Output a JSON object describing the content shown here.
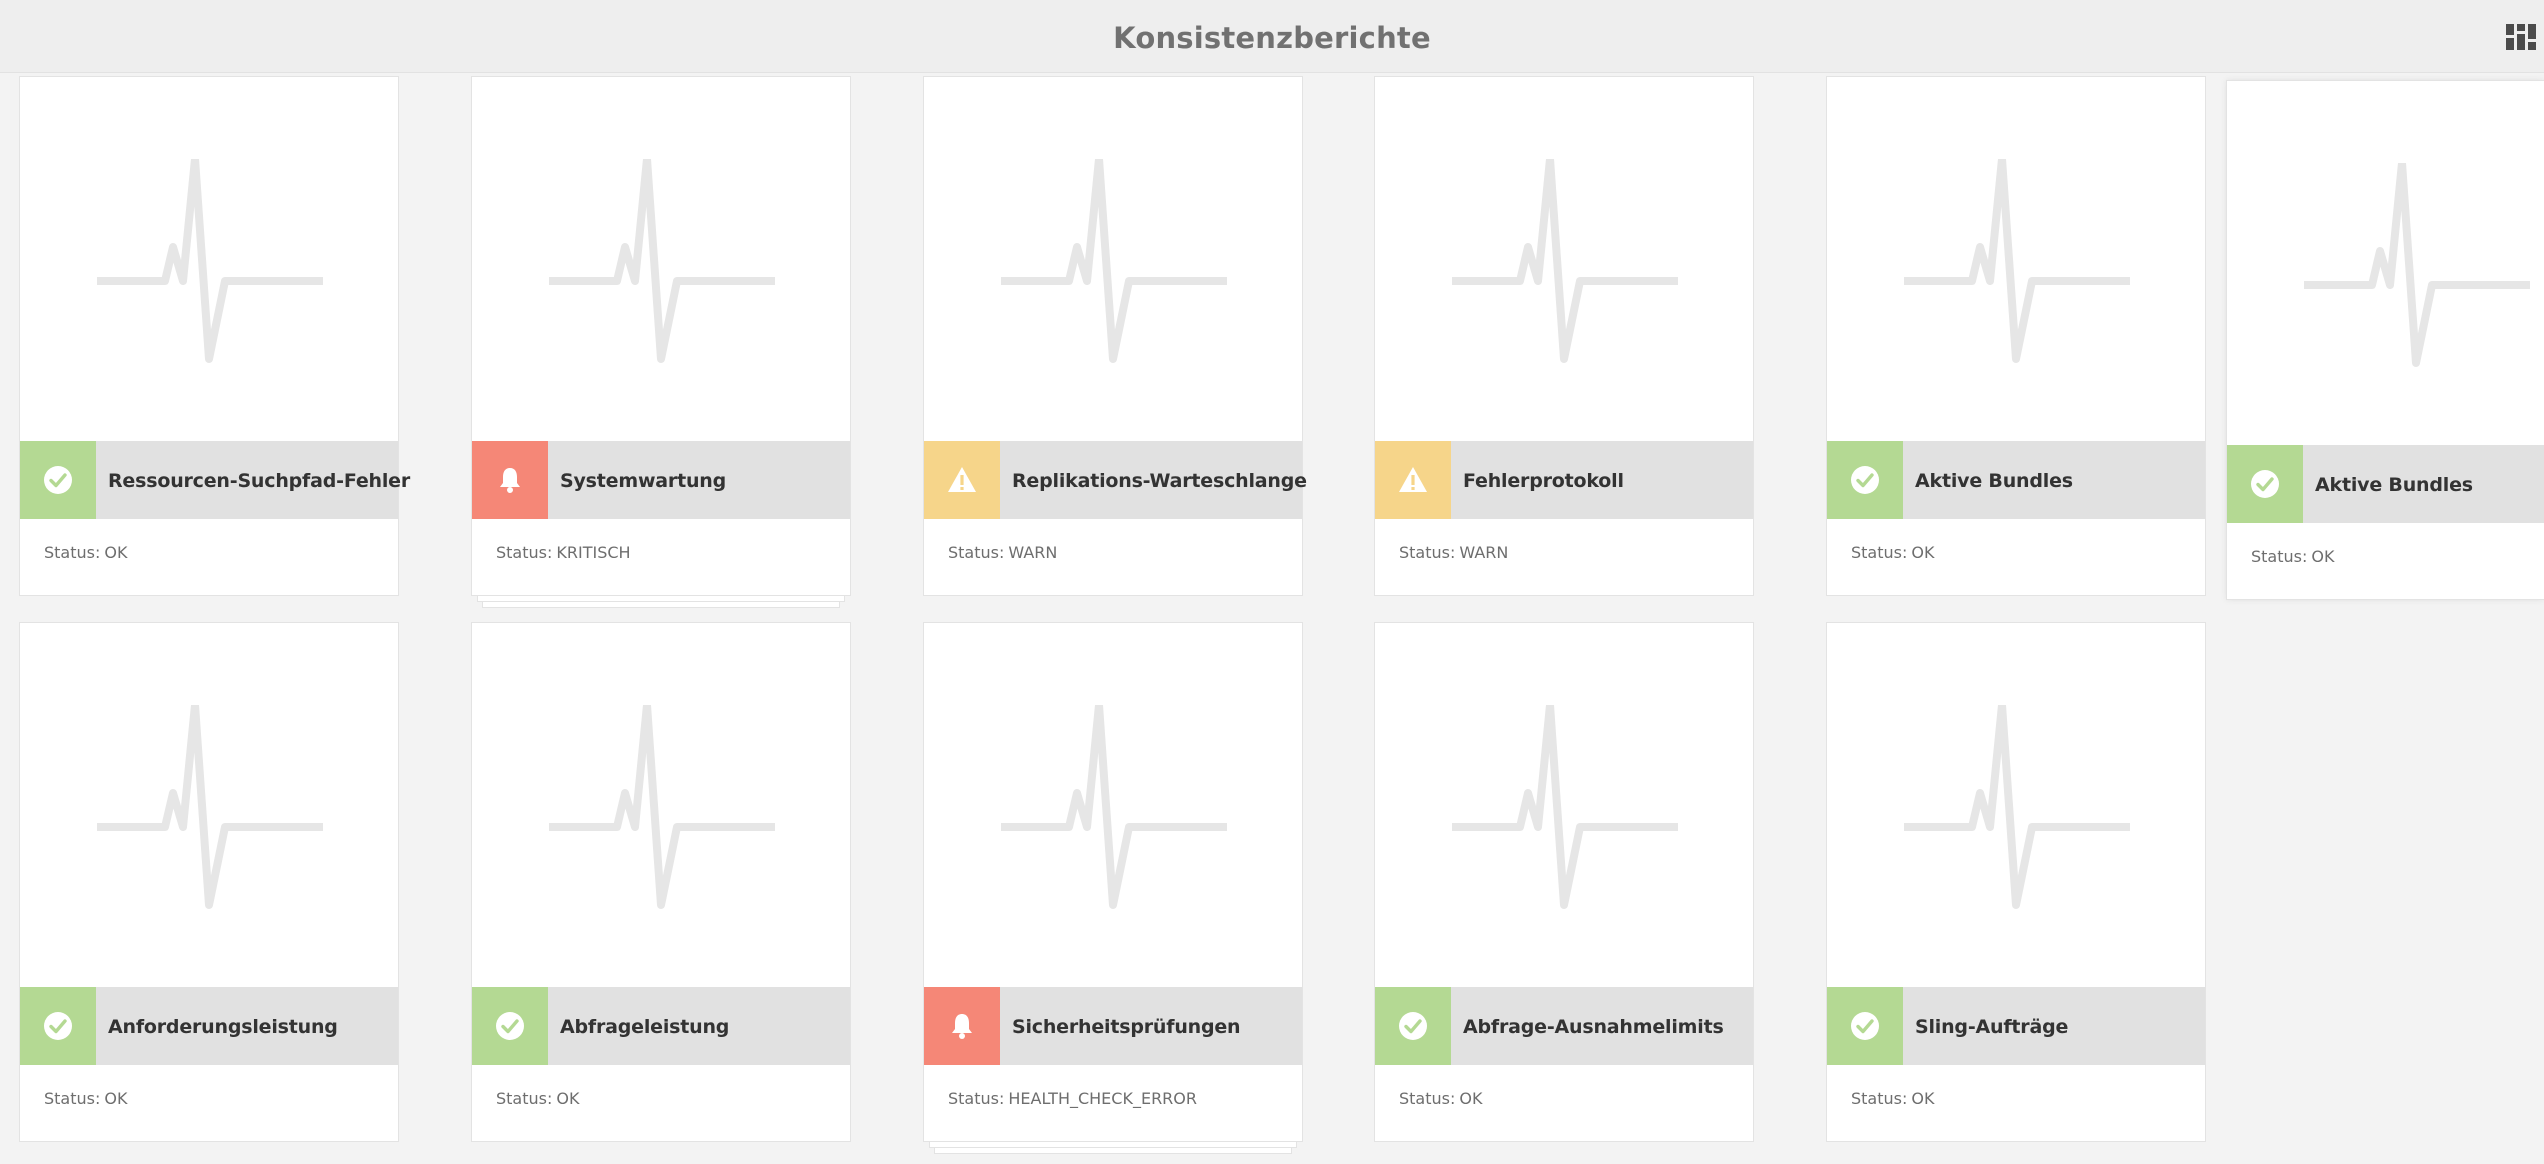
{
  "header": {
    "title": "Konsistenzberichte",
    "view_switch_icon": "card-view-icon"
  },
  "colors": {
    "ok": "#b4d993",
    "critical": "#f58777",
    "warn": "#f6d58a",
    "bar": "#e1e1e1",
    "background": "#f3f3f3"
  },
  "status_label": "Status:",
  "cards": [
    {
      "title": "Ressourcen-Suchpfad-Fehler",
      "status": "OK",
      "icon": "check-icon"
    },
    {
      "title": "Systemwartung",
      "status": "KRITISCH",
      "icon": "bell-icon"
    },
    {
      "title": "Replikations-Warteschlange",
      "status": "WARN",
      "icon": "warning-icon"
    },
    {
      "title": "Fehlerprotokoll",
      "status": "WARN",
      "icon": "warning-icon"
    },
    {
      "title": "Aktive Bundles",
      "status": "OK",
      "icon": "check-icon"
    },
    {
      "title": "Aktive Bundles",
      "status": "OK",
      "icon": "check-icon"
    },
    {
      "title": "Anforderungsleistung",
      "status": "OK",
      "icon": "check-icon"
    },
    {
      "title": "Abfrageleistung",
      "status": "OK",
      "icon": "check-icon"
    },
    {
      "title": "Sicherheitsprüfungen",
      "status": "HEALTH_CHECK_ERROR",
      "icon": "bell-icon"
    },
    {
      "title": "Abfrage-Ausnahmelimits",
      "status": "OK",
      "icon": "check-icon"
    },
    {
      "title": "Sling-Aufträge",
      "status": "OK",
      "icon": "check-icon"
    }
  ]
}
